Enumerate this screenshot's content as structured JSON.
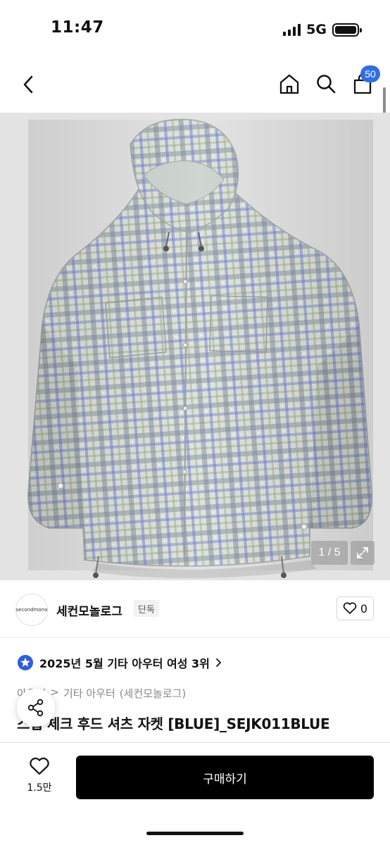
{
  "status": {
    "time": "11:47",
    "network": "5G"
  },
  "nav": {
    "cart_count": "50"
  },
  "image": {
    "page_indicator": "1 / 5"
  },
  "brand": {
    "logo_text": "secondmono",
    "name": "세컨모놀로그",
    "tag": "단독",
    "like_count": "0"
  },
  "ranking": {
    "text": "2025년 5월 기타 아우터 여성 3위"
  },
  "breadcrumb": {
    "parent": "아우터",
    "category": "기타 아우터",
    "brand": "(세컨모놀로그)"
  },
  "product": {
    "title": "스탭 체크 후드 셔츠 자켓 [BLUE]_SEJK011BLUE"
  },
  "bottom": {
    "like_count": "1.5만",
    "buy_label": "구매하기"
  },
  "colors": {
    "accent_badge": "#2f6ee6",
    "buy_button": "#000000"
  }
}
